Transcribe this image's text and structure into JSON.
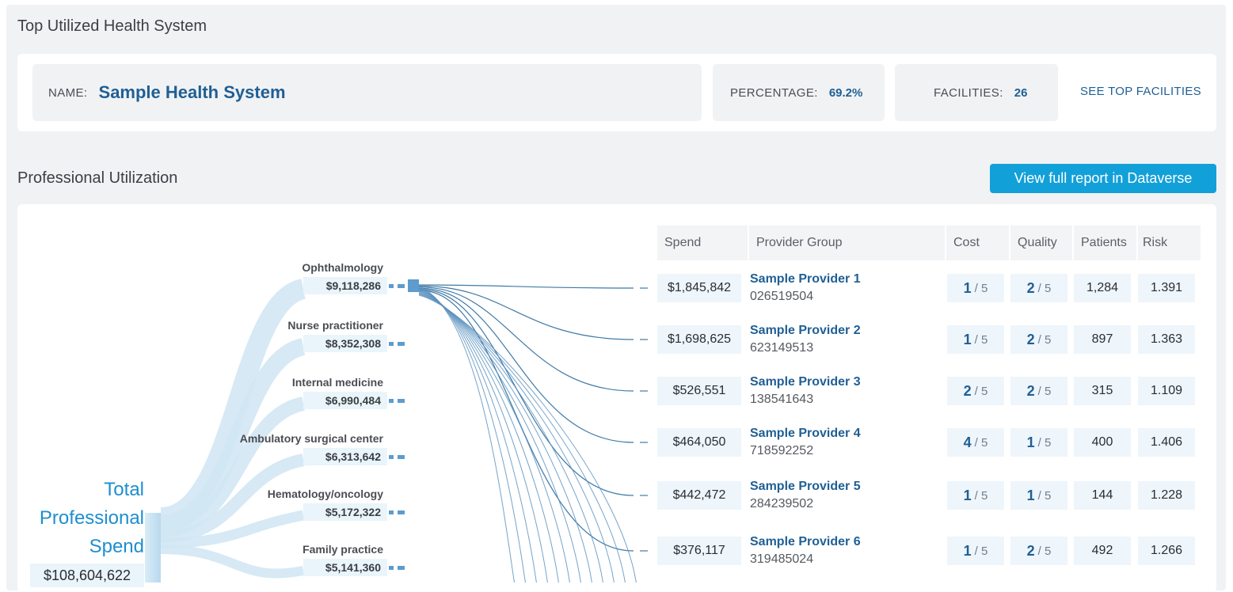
{
  "top_section": {
    "title": "Top Utilized Health System",
    "name_label": "NAME:",
    "name_value": "Sample Health System",
    "percentage_label": "PERCENTAGE:",
    "percentage_value": "69.2%",
    "facilities_label": "FACILITIES:",
    "facilities_value": "26",
    "see_top_facilities": "SEE TOP FACILITIES"
  },
  "professional": {
    "title": "Professional Utilization",
    "report_button": "View full report in Dataverse",
    "total_label_lines": [
      "Total",
      "Professional",
      "Spend"
    ],
    "total_value": "$108,604,622",
    "specialties": [
      {
        "name": "Ophthalmology",
        "spend": "$9,118,286"
      },
      {
        "name": "Nurse practitioner",
        "spend": "$8,352,308"
      },
      {
        "name": "Internal medicine",
        "spend": "$6,990,484"
      },
      {
        "name": "Ambulatory surgical center",
        "spend": "$6,313,642"
      },
      {
        "name": "Hematology/oncology",
        "spend": "$5,172,322"
      },
      {
        "name": "Family practice",
        "spend": "$5,141,360"
      }
    ],
    "table": {
      "headers": {
        "spend": "Spend",
        "provider_group": "Provider Group",
        "cost": "Cost",
        "quality": "Quality",
        "patients": "Patients",
        "risk": "Risk"
      },
      "score_of": "/ 5",
      "rows": [
        {
          "spend": "$1,845,842",
          "name": "Sample Provider 1",
          "id": "026519504",
          "cost": "1",
          "quality": "2",
          "patients": "1,284",
          "risk": "1.391"
        },
        {
          "spend": "$1,698,625",
          "name": "Sample Provider 2",
          "id": "623149513",
          "cost": "1",
          "quality": "2",
          "patients": "897",
          "risk": "1.363"
        },
        {
          "spend": "$526,551",
          "name": "Sample Provider 3",
          "id": "138541643",
          "cost": "2",
          "quality": "2",
          "patients": "315",
          "risk": "1.109"
        },
        {
          "spend": "$464,050",
          "name": "Sample Provider 4",
          "id": "718592252",
          "cost": "4",
          "quality": "1",
          "patients": "400",
          "risk": "1.406"
        },
        {
          "spend": "$442,472",
          "name": "Sample Provider 5",
          "id": "284239502",
          "cost": "1",
          "quality": "1",
          "patients": "144",
          "risk": "1.228"
        },
        {
          "spend": "$376,117",
          "name": "Sample Provider 6",
          "id": "319485024",
          "cost": "1",
          "quality": "2",
          "patients": "492",
          "risk": "1.266"
        }
      ]
    }
  }
}
